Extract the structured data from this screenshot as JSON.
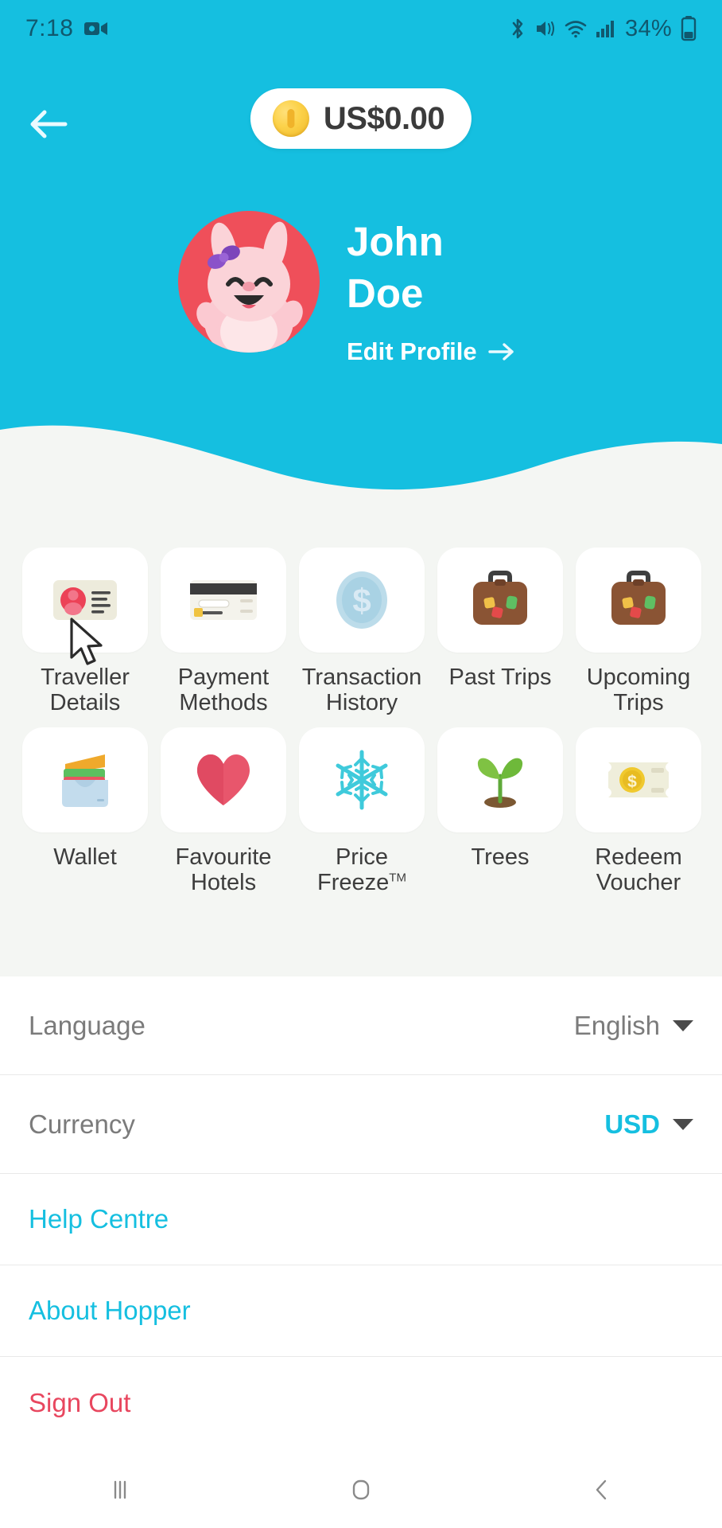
{
  "status_bar": {
    "time": "7:18",
    "battery_percent": "34%",
    "icons": [
      "screen-record-icon",
      "bluetooth-icon",
      "mute-vibrate-icon",
      "wifi-icon",
      "cellular-signal-icon",
      "battery-icon"
    ]
  },
  "header": {
    "back_icon": "back-arrow-icon",
    "balance": "US$0.00",
    "coin_icon": "coin-icon",
    "accent_color": "#15bfe0"
  },
  "profile": {
    "first_name": "John",
    "last_name": "Doe",
    "avatar_icon": "bunny-avatar",
    "avatar_bg": "#ef4f5a",
    "edit_label": "Edit Profile",
    "edit_arrow": "arrow-right-icon"
  },
  "grid": {
    "items": [
      {
        "label": "Traveller Details",
        "line1": "Traveller",
        "line2": "Details",
        "icon": "id-card-icon"
      },
      {
        "label": "Payment Methods",
        "line1": "Payment",
        "line2": "Methods",
        "icon": "credit-card-icon"
      },
      {
        "label": "Transaction History",
        "line1": "Transaction",
        "line2": "History",
        "icon": "dollar-coin-icon"
      },
      {
        "label": "Past Trips",
        "line1": "Past Trips",
        "line2": "",
        "icon": "suitcase-icon"
      },
      {
        "label": "Upcoming Trips",
        "line1": "Upcoming",
        "line2": "Trips",
        "icon": "suitcase-icon"
      },
      {
        "label": "Wallet",
        "line1": "Wallet",
        "line2": "",
        "icon": "wallet-icon"
      },
      {
        "label": "Favourite Hotels",
        "line1": "Favourite",
        "line2": "Hotels",
        "icon": "heart-icon"
      },
      {
        "label": "Price Freeze",
        "line1": "Price",
        "line2": "Freeze",
        "line2_sup": "TM",
        "icon": "snowflake-icon"
      },
      {
        "label": "Trees",
        "line1": "Trees",
        "line2": "",
        "icon": "seedling-icon"
      },
      {
        "label": "Redeem Voucher",
        "line1": "Redeem",
        "line2": "Voucher",
        "icon": "voucher-icon"
      }
    ]
  },
  "settings": {
    "language": {
      "label": "Language",
      "value": "English"
    },
    "currency": {
      "label": "Currency",
      "value": "USD",
      "value_color": "#15bfe0"
    },
    "help_centre": "Help Centre",
    "about": "About Hopper",
    "sign_out": "Sign Out",
    "sign_out_color": "#e8475f"
  },
  "nav_bar": {
    "recents": "recents-icon",
    "home": "home-icon",
    "back": "back-icon"
  }
}
